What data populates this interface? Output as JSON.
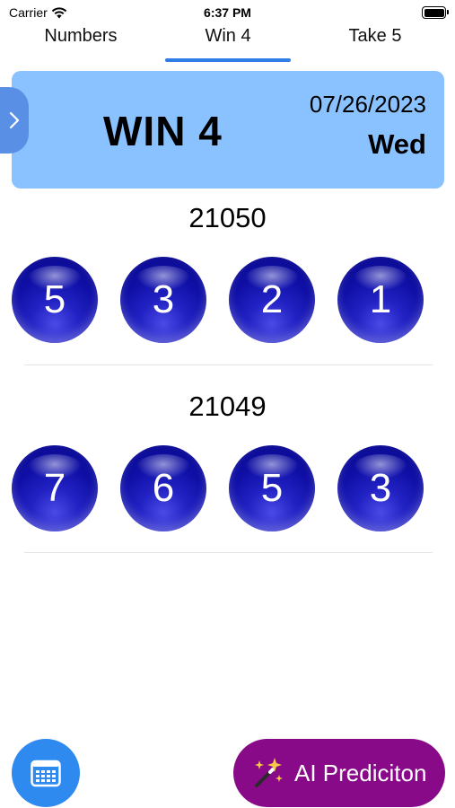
{
  "status": {
    "carrier": "Carrier",
    "time": "6:37 PM"
  },
  "tabs": [
    {
      "label": "Numbers"
    },
    {
      "label": "Win 4"
    },
    {
      "label": "Take 5"
    }
  ],
  "header": {
    "game": "WIN 4",
    "date": "07/26/2023",
    "day": "Wed"
  },
  "draws": [
    {
      "number": "21050",
      "balls": [
        "5",
        "3",
        "2",
        "1"
      ]
    },
    {
      "number": "21049",
      "balls": [
        "7",
        "6",
        "5",
        "3"
      ]
    }
  ],
  "buttons": {
    "ai_label": "AI Prediciton"
  },
  "icons": {
    "side": "chevron-right-icon",
    "calendar": "calendar-icon",
    "ai": "magic-wand-icon",
    "wifi": "wifi-icon",
    "battery": "battery-icon"
  },
  "colors": {
    "header_bg": "#8ac2ff",
    "tab_indicator": "#2f7ee6",
    "ball": "#0f0fa6",
    "calendar_button": "#2f8af0",
    "ai_button": "#880a88"
  }
}
